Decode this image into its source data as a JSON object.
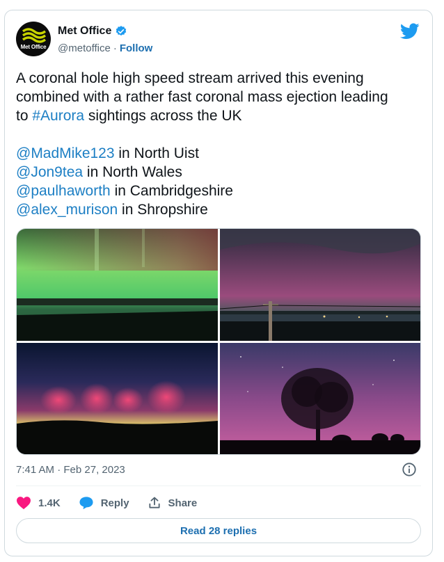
{
  "author": {
    "name": "Met Office",
    "handle": "@metoffice",
    "separator": "·",
    "follow_label": "Follow",
    "avatar_text": "Met Office",
    "verified_color": "#1d9bf0"
  },
  "brand_icon": "twitter-bird-icon",
  "tweet": {
    "lines": [
      "A coronal hole high speed stream arrived this evening",
      "combined with a rather fast coronal mass ejection leading",
      "to"
    ],
    "hashtag": "#Aurora",
    "line3_rest": " sightings across the UK",
    "credits": [
      {
        "mention": "@MadMike123",
        "place": " in North Uist"
      },
      {
        "mention": "@Jon9tea",
        "place": " in North Wales"
      },
      {
        "mention": "@paulhaworth",
        "place": " in Cambridgeshire"
      },
      {
        "mention": "@alex_murison",
        "place": " in Shropshire"
      }
    ]
  },
  "media": {
    "photos": [
      "aurora-photo-north-uist",
      "aurora-photo-north-wales",
      "aurora-photo-cambridgeshire",
      "aurora-photo-shropshire"
    ]
  },
  "timestamp": "7:41 AM · Feb 27, 2023",
  "actions": {
    "likes": "1.4K",
    "reply_label": "Reply",
    "share_label": "Share"
  },
  "read_replies_label": "Read 28 replies",
  "colors": {
    "link": "#1d7fc4",
    "heart": "#f91880",
    "reply_bubble": "#1d9bf0"
  }
}
